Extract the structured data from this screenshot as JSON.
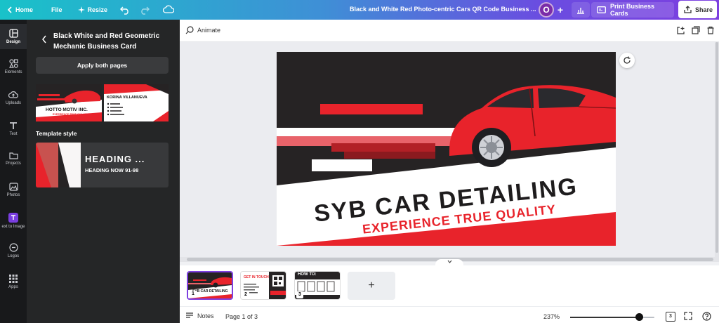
{
  "topbar": {
    "home_label": "Home",
    "file_label": "File",
    "resize_label": "Resize",
    "doc_title": "Black and White Red Photo-centric Cars QR Code Business ...",
    "avatar_initial": "O",
    "print_label": "Print Business Cards",
    "share_label": "Share"
  },
  "rail": {
    "items": [
      {
        "label": "Design"
      },
      {
        "label": "Elements"
      },
      {
        "label": "Uploads"
      },
      {
        "label": "Text"
      },
      {
        "label": "Projects"
      },
      {
        "label": "Photos"
      },
      {
        "label": "ext to Image"
      },
      {
        "label": "Logos"
      },
      {
        "label": "Apps"
      }
    ]
  },
  "panel": {
    "title": "Black White and Red Geometric Mechanic Business Card",
    "apply_label": "Apply both pages",
    "thumb1_text": "HOTTO MOTIV INC.",
    "thumb1_sub": "EXPERIENCE TRUE QUALITY",
    "thumb2_name": "KORINA VILLANUEVA",
    "template_style_label": "Template style",
    "style_heading": "HEADING ...",
    "style_sub": "HEADING NOW 91-98"
  },
  "editor": {
    "animate_label": "Animate"
  },
  "card": {
    "headline": "SYB CAR DETAILING",
    "tagline": "EXPERIENCE TRUE QUALITY",
    "colors": {
      "dark": "#262324",
      "red": "#e8232b",
      "white": "#ffffff"
    }
  },
  "pages": {
    "thumbs": [
      {
        "num": "1",
        "text": "SYB CAR DETAILING"
      },
      {
        "num": "2",
        "text": "GET IN TOUCH"
      },
      {
        "num": "3",
        "text": "HOW TO:"
      }
    ],
    "add_label": "+"
  },
  "bottombar": {
    "notes_label": "Notes",
    "page_indicator": "Page 1 of 3",
    "zoom": "237%",
    "page_count": "3"
  }
}
